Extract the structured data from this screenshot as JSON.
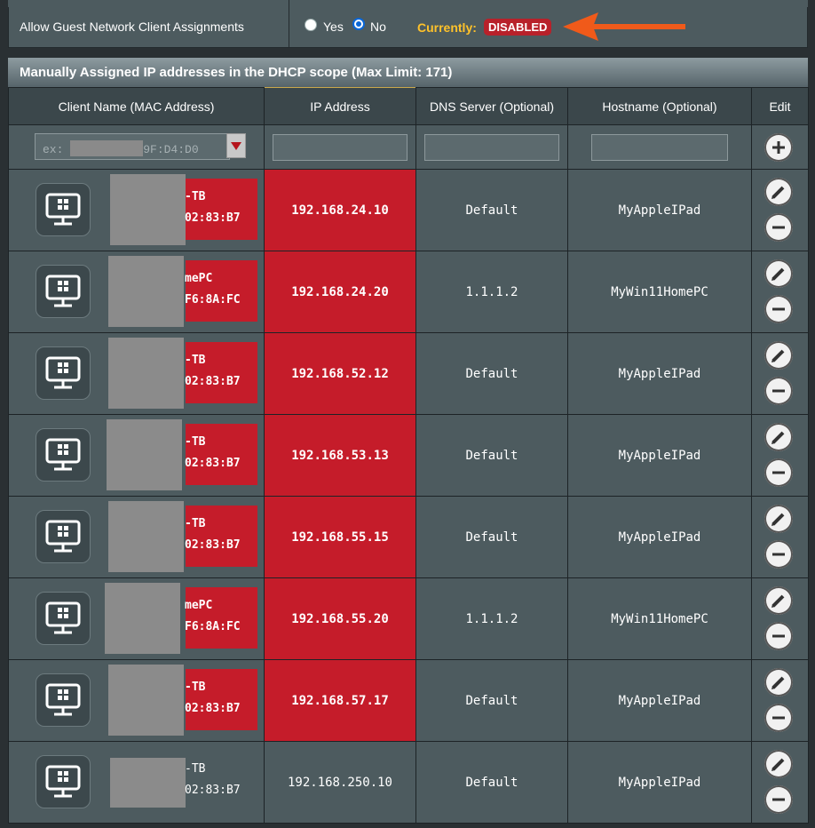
{
  "guest_setting": {
    "label": "Allow Guest Network Client Assignments",
    "yes_label": "Yes",
    "no_label": "No",
    "selected": "No",
    "currently_label": "Currently:",
    "status": "DISABLED"
  },
  "section": {
    "title": "Manually Assigned IP addresses in the DHCP scope (Max Limit: 171)"
  },
  "table": {
    "headers": [
      "Client Name (MAC Address)",
      "IP Address",
      "DNS Server (Optional)",
      "Hostname (Optional)",
      "Edit"
    ],
    "mac_placeholder_prefix": "ex:",
    "mac_placeholder_suffix": "9F:D4:D0",
    "rows": [
      {
        "name_suffix": "-TB",
        "mac_suffix": "02:83:B7",
        "ip": "192.168.24.10",
        "dns": "Default",
        "hostname": "MyAppleIPad",
        "highlight": true
      },
      {
        "name_suffix": "mePC",
        "mac_suffix": "F6:8A:FC",
        "ip": "192.168.24.20",
        "dns": "1.1.1.2",
        "hostname": "MyWin11HomePC",
        "highlight": true
      },
      {
        "name_suffix": "-TB",
        "mac_suffix": "02:83:B7",
        "ip": "192.168.52.12",
        "dns": "Default",
        "hostname": "MyAppleIPad",
        "highlight": true
      },
      {
        "name_suffix": "-TB",
        "mac_suffix": "02:83:B7",
        "ip": "192.168.53.13",
        "dns": "Default",
        "hostname": "MyAppleIPad",
        "highlight": true
      },
      {
        "name_suffix": "-TB",
        "mac_suffix": "02:83:B7",
        "ip": "192.168.55.15",
        "dns": "Default",
        "hostname": "MyAppleIPad",
        "highlight": true
      },
      {
        "name_suffix": "mePC",
        "mac_suffix": "F6:8A:FC",
        "ip": "192.168.55.20",
        "dns": "1.1.1.2",
        "hostname": "MyWin11HomePC",
        "highlight": true
      },
      {
        "name_suffix": "-TB",
        "mac_suffix": "02:83:B7",
        "ip": "192.168.57.17",
        "dns": "Default",
        "hostname": "MyAppleIPad",
        "highlight": true
      },
      {
        "name_suffix": "-TB",
        "mac_suffix": "02:83:B7",
        "ip": "192.168.250.10",
        "dns": "Default",
        "hostname": "MyAppleIPad",
        "highlight": false
      }
    ]
  },
  "icons": {
    "client": "windows-pc-icon",
    "edit": "pencil-icon",
    "delete": "minus-circle-icon",
    "add": "plus-circle-icon",
    "annotation": "orange-arrow-icon"
  },
  "colors": {
    "highlight_red": "#c51c2a",
    "status_yellow": "#ffc22a",
    "arrow_orange": "#f05a1a"
  }
}
